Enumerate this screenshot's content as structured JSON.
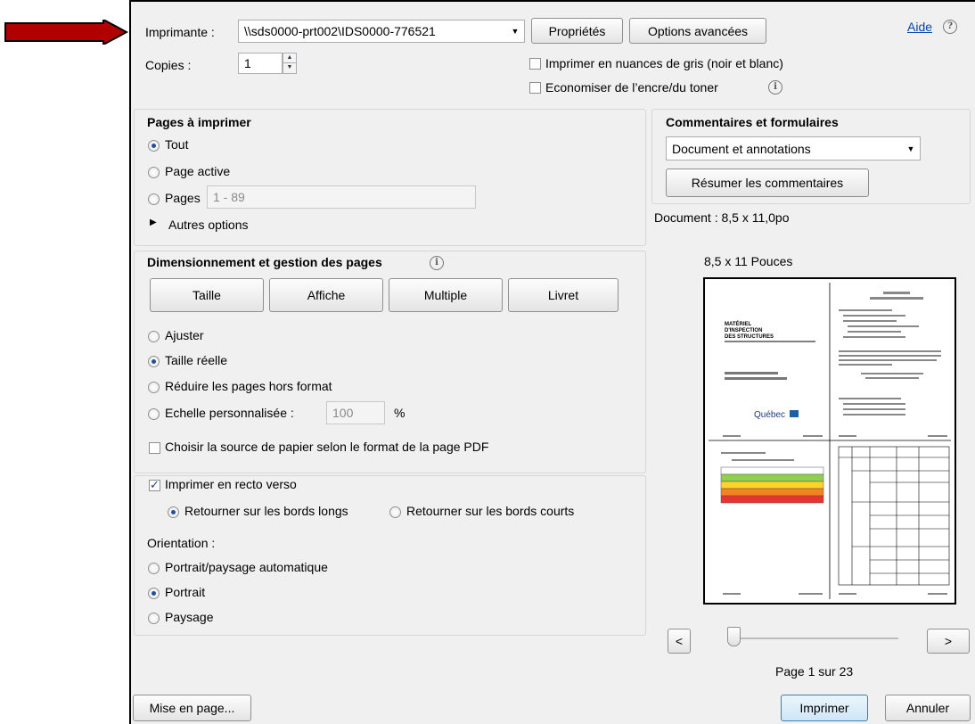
{
  "printer": {
    "label": "Imprimante :",
    "value": "\\\\sds0000-prt002\\IDS0000-776521",
    "properties_button": "Propriétés",
    "advanced_button": "Options avancées",
    "help_link": "Aide",
    "help_icon": "?"
  },
  "copies": {
    "label": "Copies :",
    "value": "1"
  },
  "options": {
    "grayscale": {
      "label": "Imprimer en nuances de gris (noir et blanc)",
      "checked": false
    },
    "save_ink": {
      "label": "Economiser de l’encre/du toner",
      "checked": false
    }
  },
  "pages": {
    "title": "Pages à imprimer",
    "all": "Tout",
    "current": "Page active",
    "pages_label": "Pages",
    "pages_value": "1 - 89",
    "more": "Autres options"
  },
  "sizing": {
    "title": "Dimensionnement et gestion des pages",
    "tabs": {
      "size": "Taille",
      "poster": "Affiche",
      "multiple": "Multiple",
      "booklet": "Livret"
    },
    "fit": "Ajuster",
    "actual": "Taille réelle",
    "shrink": "Réduire les pages hors format",
    "custom": "Echelle personnalisée :",
    "custom_value": "100",
    "percent": "%",
    "paper_source": "Choisir la source de papier selon le format de la page PDF"
  },
  "duplex": {
    "label": "Imprimer en recto verso",
    "long_edge": "Retourner sur les bords longs",
    "short_edge": "Retourner sur les bords courts"
  },
  "orientation": {
    "title": "Orientation :",
    "auto": "Portrait/paysage automatique",
    "portrait": "Portrait",
    "landscape": "Paysage"
  },
  "comments": {
    "title": "Commentaires et formulaires",
    "value": "Document et annotations",
    "summarize_button": "Résumer les commentaires"
  },
  "preview": {
    "document_size": "Document : 8,5 x 11,0po",
    "paper_size": "8,5 x 11 Pouces",
    "prev_button": "<",
    "next_button": ">",
    "page_indicator": "Page 1 sur 23",
    "slider_position": 0,
    "thumb": {
      "title": "MATÉRIEL D'INSPECTION DES STRUCTURES",
      "brand": "Québec"
    }
  },
  "footer": {
    "page_setup": "Mise en page...",
    "print": "Imprimer",
    "cancel": "Annuler"
  },
  "colors": {
    "arrow": "#b00000",
    "accent": "#1f4f9d",
    "link": "#0645ad"
  }
}
